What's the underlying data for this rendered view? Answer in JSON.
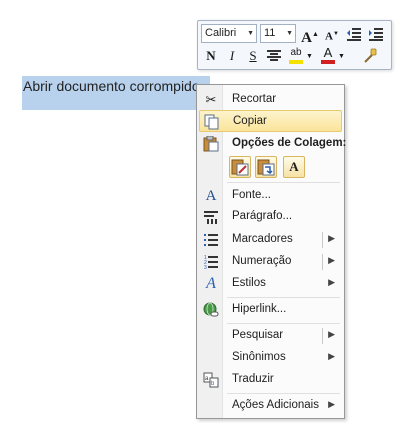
{
  "document": {
    "selected_text": "Abrir documento corrompido"
  },
  "mini_toolbar": {
    "font_name": "Calibri",
    "font_size": "11",
    "grow_font_label": "A",
    "shrink_font_label": "A",
    "bold_label": "N",
    "italic_label": "I",
    "underline_label": "S",
    "highlight_label": "ab",
    "font_color_label": "A",
    "accent_highlight_color": "#f5e100",
    "accent_font_color": "#d02020"
  },
  "context_menu": {
    "cut": "Recortar",
    "copy": "Copiar",
    "paste_options_header": "Opções de Colagem:",
    "paste_text_only_label": "A",
    "font": "Fonte...",
    "paragraph": "Parágrafo...",
    "bullets": "Marcadores",
    "numbering": "Numeração",
    "styles": "Estilos",
    "hyperlink": "Hiperlink...",
    "search": "Pesquisar",
    "synonyms": "Sinônimos",
    "translate": "Traduzir",
    "additional_actions": "Ações Adicionais",
    "highlight_color": "#fbe49a"
  }
}
